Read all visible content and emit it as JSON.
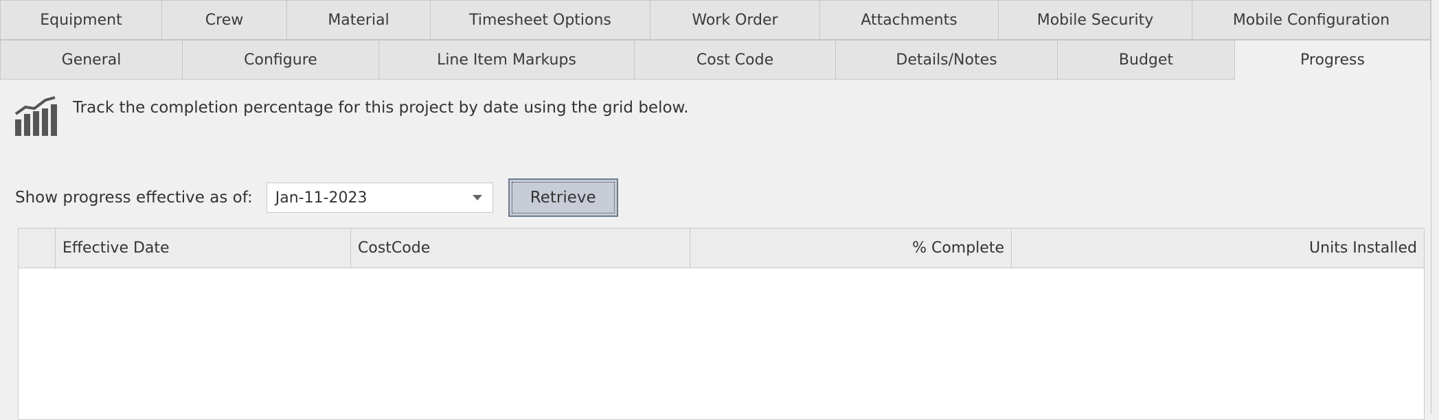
{
  "tabs_row1": [
    {
      "label": "Equipment",
      "w": 236
    },
    {
      "label": "Crew",
      "w": 182
    },
    {
      "label": "Material",
      "w": 209
    },
    {
      "label": "Timesheet Options",
      "w": 320
    },
    {
      "label": "Work Order",
      "w": 247
    },
    {
      "label": "Attachments",
      "w": 260
    },
    {
      "label": "Mobile Security",
      "w": 282
    },
    {
      "label": "Mobile Configuration",
      "w": 347
    }
  ],
  "tabs_row2": [
    {
      "label": "General",
      "w": 266,
      "active": false
    },
    {
      "label": "Configure",
      "w": 286,
      "active": false
    },
    {
      "label": "Line Item Markups",
      "w": 372,
      "active": false
    },
    {
      "label": "Cost Code",
      "w": 293,
      "active": false
    },
    {
      "label": "Details/Notes",
      "w": 323,
      "active": false
    },
    {
      "label": "Budget",
      "w": 258,
      "active": false
    },
    {
      "label": "Progress",
      "w": 285,
      "active": true
    }
  ],
  "info": {
    "icon": "chart-bars-icon",
    "text": "Track the completion percentage for this project by date using the grid below."
  },
  "filter": {
    "label": "Show progress effective as of:",
    "date_value": "Jan-11-2023",
    "retrieve_label": "Retrieve"
  },
  "grid": {
    "columns": [
      {
        "label": "",
        "w": 54,
        "align": "left"
      },
      {
        "label": "Effective Date",
        "w": 430,
        "align": "left"
      },
      {
        "label": "CostCode",
        "w": 494,
        "align": "left"
      },
      {
        "label": "% Complete",
        "w": 468,
        "align": "right"
      },
      {
        "label": "Units Installed",
        "w": 600,
        "align": "right"
      }
    ],
    "rows": []
  }
}
